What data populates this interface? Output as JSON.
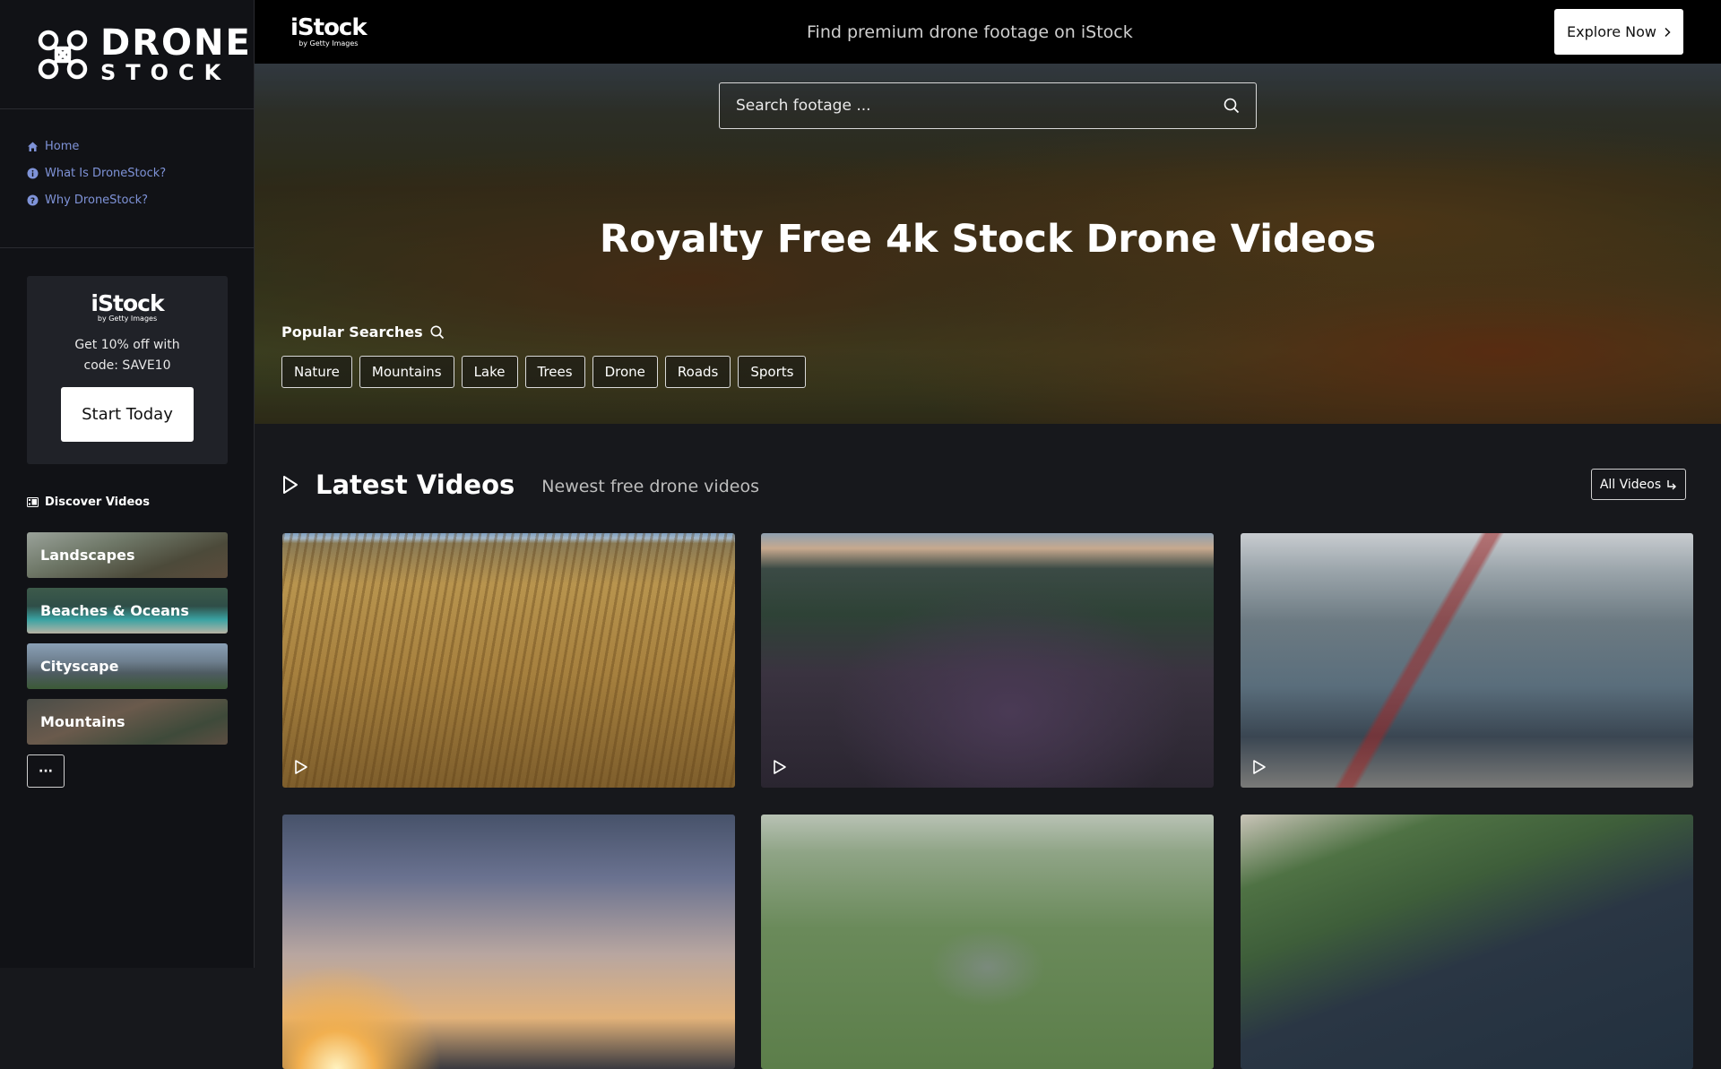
{
  "sidebar": {
    "logo": {
      "line1": "DRONE",
      "line2": "STOCK"
    },
    "nav": [
      {
        "label": "Home",
        "icon": "home-icon"
      },
      {
        "label": "What Is DroneStock?",
        "icon": "info-icon"
      },
      {
        "label": "Why DroneStock?",
        "icon": "question-icon"
      }
    ],
    "promo": {
      "brand": "iStock",
      "brand_sub": "by Getty Images",
      "text": "Get 10% off with code: SAVE10",
      "button": "Start Today"
    },
    "discover_label": "Discover Videos",
    "categories": [
      "Landscapes",
      "Beaches & Oceans",
      "Cityscape",
      "Mountains"
    ],
    "more_label": "···"
  },
  "topbar": {
    "brand": "iStock",
    "brand_sub": "by Getty Images",
    "tagline": "Find premium drone footage on iStock",
    "explore": "Explore Now"
  },
  "hero": {
    "search_placeholder": "Search footage ...",
    "title": "Royalty Free 4k Stock Drone Videos",
    "popular_label": "Popular Searches",
    "chips": [
      "Nature",
      "Mountains",
      "Lake",
      "Trees",
      "Drone",
      "Roads",
      "Sports"
    ]
  },
  "latest": {
    "title": "Latest Videos",
    "subtitle": "Newest free drone videos",
    "all_videos": "All Videos"
  },
  "colors": {
    "nav_link": "#7f93d8",
    "background": "#17181c",
    "sidebar": "#111216"
  }
}
